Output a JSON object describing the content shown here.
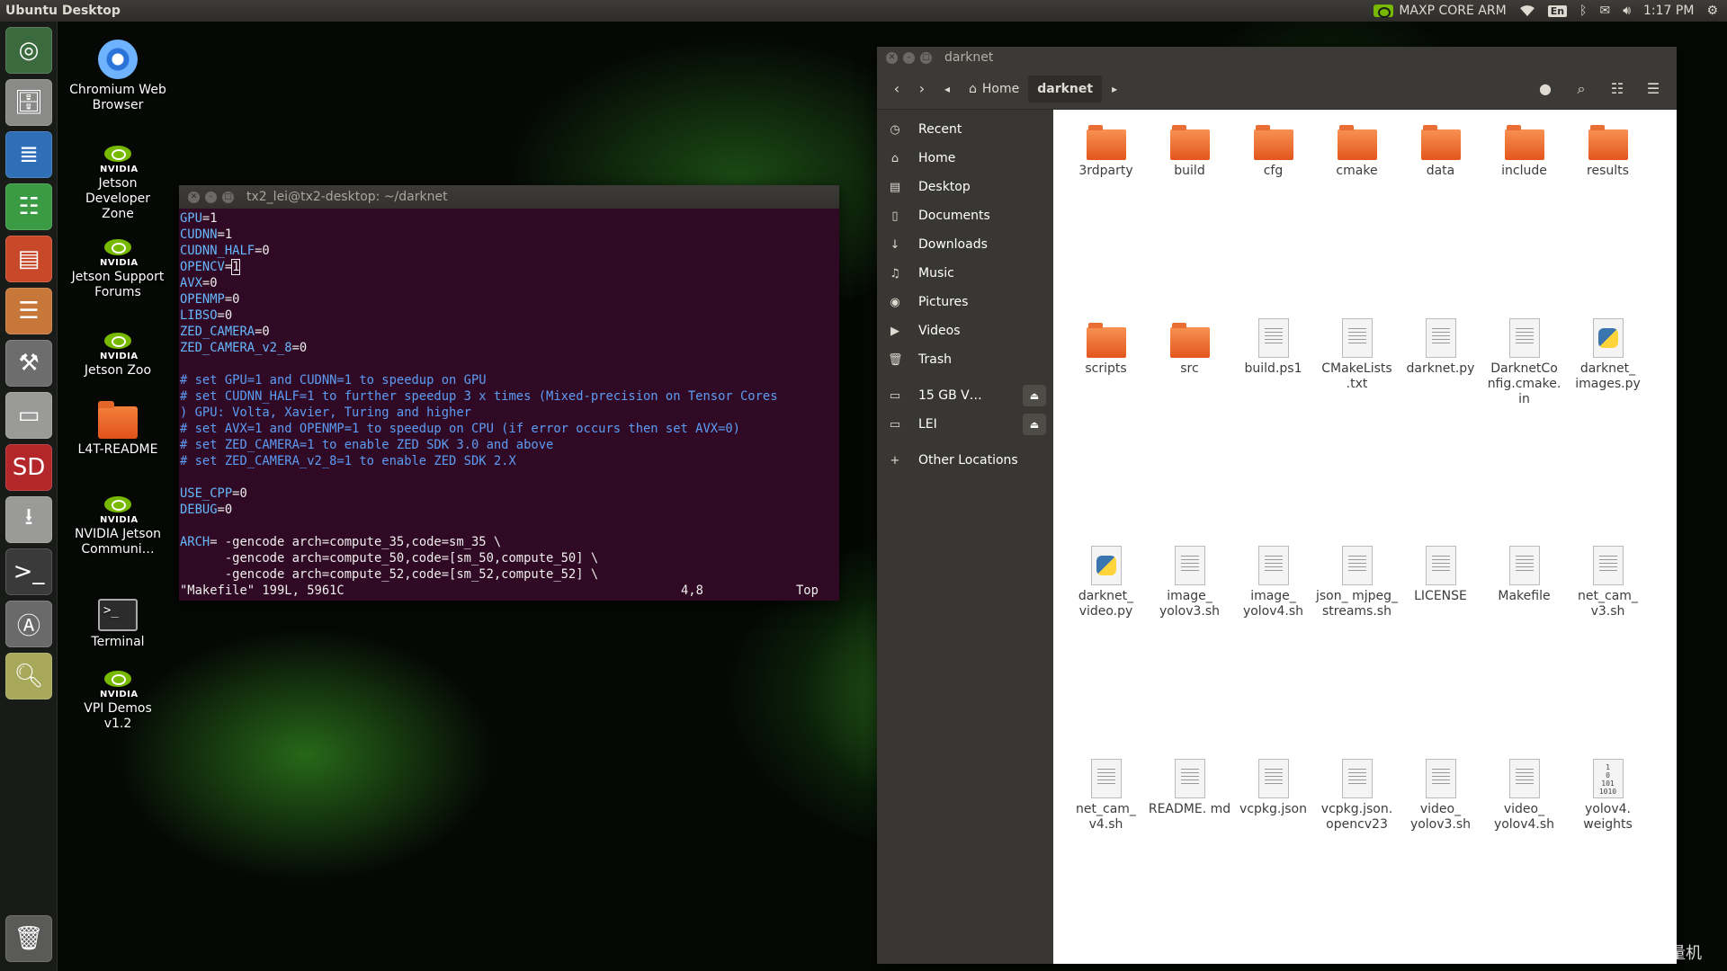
{
  "top_panel": {
    "title": "Ubuntu Desktop",
    "power_mode": "MAXP CORE ARM",
    "keyboard": "En",
    "time": "1:17 PM"
  },
  "launcher": {
    "items": [
      "ubuntu-icon",
      "files-icon",
      "writer-icon",
      "calc-icon",
      "impress-icon",
      "software-icon",
      "settings-icon",
      "drive-icon",
      "sd-card-icon",
      "usb-drive-icon",
      "terminal-icon",
      "updater-icon",
      "image-viewer-icon",
      "trash-icon"
    ]
  },
  "desktop": {
    "icons": [
      {
        "label": "Chromium Web Browser"
      },
      {
        "label": "Jetson Developer Zone",
        "brand": "NVIDIA"
      },
      {
        "label": "Jetson Support Forums",
        "brand": "NVIDIA"
      },
      {
        "label": "Jetson Zoo",
        "brand": "NVIDIA"
      },
      {
        "label": "L4T-README"
      },
      {
        "label": "NVIDIA Jetson Communi…",
        "brand": "NVIDIA"
      },
      {
        "label": "Terminal"
      },
      {
        "label": "VPI Demos v1.2",
        "brand": "NVIDIA"
      }
    ]
  },
  "terminal": {
    "title": "tx2_lei@tx2-desktop: ~/darknet",
    "lines": [
      {
        "key": "GPU",
        "rest": "=1"
      },
      {
        "key": "CUDNN",
        "rest": "=1"
      },
      {
        "key": "CUDNN_HALF",
        "rest": "=0"
      },
      {
        "key": "OPENCV",
        "rest": "=",
        "cursor": "1"
      },
      {
        "key": "AVX",
        "rest": "=0"
      },
      {
        "key": "OPENMP",
        "rest": "=0"
      },
      {
        "key": "LIBSO",
        "rest": "=0"
      },
      {
        "key": "ZED_CAMERA",
        "rest": "=0"
      },
      {
        "key": "ZED_CAMERA_v2_8",
        "rest": "=0"
      },
      {
        "text": ""
      },
      {
        "comment": "# set GPU=1 and CUDNN=1 to speedup on GPU"
      },
      {
        "comment": "# set CUDNN_HALF=1 to further speedup 3 x times (Mixed-precision on Tensor Cores"
      },
      {
        "comment": ") GPU: Volta, Xavier, Turing and higher"
      },
      {
        "comment": "# set AVX=1 and OPENMP=1 to speedup on CPU (if error occurs then set AVX=0)"
      },
      {
        "comment": "# set ZED_CAMERA=1 to enable ZED SDK 3.0 and above"
      },
      {
        "comment": "# set ZED_CAMERA_v2_8=1 to enable ZED SDK 2.X"
      },
      {
        "text": ""
      },
      {
        "key": "USE_CPP",
        "rest": "=0"
      },
      {
        "key": "DEBUG",
        "rest": "=0"
      },
      {
        "text": ""
      },
      {
        "key": "ARCH",
        "rest": "= -gencode arch=compute_35,code=sm_35 \\"
      },
      {
        "text": "      -gencode arch=compute_50,code=[sm_50,compute_50] \\"
      },
      {
        "text": "      -gencode arch=compute_52,code=[sm_52,compute_52] \\"
      }
    ],
    "status": {
      "file": "\"Makefile\" 199L, 5961C",
      "position": "4,8",
      "scroll": "Top"
    }
  },
  "files": {
    "title": "darknet",
    "breadcrumb": {
      "home": "Home",
      "current": "darknet"
    },
    "sidebar": {
      "places": [
        {
          "label": "Recent",
          "icon": "clock-icon"
        },
        {
          "label": "Home",
          "icon": "home-icon"
        },
        {
          "label": "Desktop",
          "icon": "desktop-folder-icon"
        },
        {
          "label": "Documents",
          "icon": "document-icon"
        },
        {
          "label": "Downloads",
          "icon": "download-icon"
        },
        {
          "label": "Music",
          "icon": "music-icon"
        },
        {
          "label": "Pictures",
          "icon": "camera-icon"
        },
        {
          "label": "Videos",
          "icon": "video-icon"
        },
        {
          "label": "Trash",
          "icon": "trash-icon"
        }
      ],
      "devices": [
        {
          "label": "15 GB V…"
        },
        {
          "label": "LEI"
        }
      ],
      "other": "Other Locations"
    },
    "items": [
      {
        "name": "3rdparty",
        "type": "folder"
      },
      {
        "name": "build",
        "type": "folder"
      },
      {
        "name": "cfg",
        "type": "folder"
      },
      {
        "name": "cmake",
        "type": "folder"
      },
      {
        "name": "data",
        "type": "folder"
      },
      {
        "name": "include",
        "type": "folder"
      },
      {
        "name": "results",
        "type": "folder"
      },
      {
        "name": "scripts",
        "type": "folder"
      },
      {
        "name": "src",
        "type": "folder"
      },
      {
        "name": "build.ps1",
        "type": "doc"
      },
      {
        "name": "CMakeLists .txt",
        "type": "doc"
      },
      {
        "name": "darknet.py",
        "type": "doc"
      },
      {
        "name": "DarknetCo nfig.cmake. in",
        "type": "doc"
      },
      {
        "name": "darknet_ images.py",
        "type": "py"
      },
      {
        "name": "darknet_ video.py",
        "type": "py"
      },
      {
        "name": "image_ yolov3.sh",
        "type": "doc"
      },
      {
        "name": "image_ yolov4.sh",
        "type": "doc"
      },
      {
        "name": "json_ mjpeg_ streams.sh",
        "type": "doc"
      },
      {
        "name": "LICENSE",
        "type": "doc"
      },
      {
        "name": "Makefile",
        "type": "doc"
      },
      {
        "name": "net_cam_ v3.sh",
        "type": "doc"
      },
      {
        "name": "net_cam_ v4.sh",
        "type": "doc"
      },
      {
        "name": "README. md",
        "type": "doc"
      },
      {
        "name": "vcpkg.json",
        "type": "doc"
      },
      {
        "name": "vcpkg.json. opencv23",
        "type": "doc"
      },
      {
        "name": "video_ yolov3.sh",
        "type": "doc"
      },
      {
        "name": "video_ yolov4.sh",
        "type": "doc"
      },
      {
        "name": "yolov4. weights",
        "type": "bin"
      }
    ]
  },
  "watermark": "CSDN @鲁棒最小二乘支持向量机"
}
